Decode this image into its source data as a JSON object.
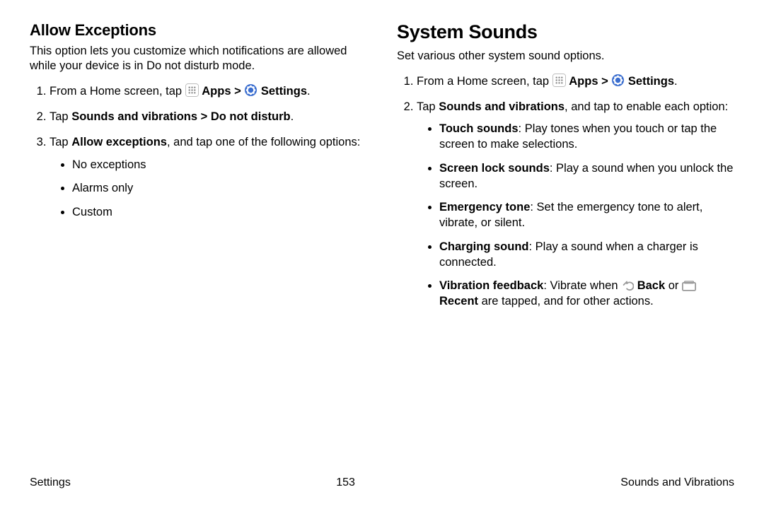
{
  "left": {
    "heading": "Allow Exceptions",
    "lead": "This option lets you customize which notifications are allowed while your device is in Do not disturb mode.",
    "step1_pre": "From a Home screen, tap ",
    "apps": "Apps",
    "gt": " > ",
    "settings": "Settings",
    "period": ".",
    "step2_pre": "Tap ",
    "step2_bold": "Sounds and vibrations > Do not disturb",
    "step3_pre": "Tap ",
    "step3_bold": "Allow exceptions",
    "step3_post": ", and tap one of the following options:",
    "opts": [
      "No exceptions",
      "Alarms only",
      "Custom"
    ]
  },
  "right": {
    "heading": "System Sounds",
    "lead": "Set various other system sound options.",
    "step1_pre": "From a Home screen, tap ",
    "apps": "Apps",
    "gt": " > ",
    "settings": "Settings",
    "period": ".",
    "step2_pre": "Tap ",
    "step2_bold": "Sounds and vibrations",
    "step2_post": ", and tap to enable each option:",
    "opts": {
      "touch_b": "Touch sounds",
      "touch_t": ": Play tones when you touch or tap the screen to make selections.",
      "lock_b": "Screen lock sounds",
      "lock_t": ": Play a sound when you unlock the screen.",
      "emerg_b": "Emergency tone",
      "emerg_t": ": Set the emergency tone to alert, vibrate, or silent.",
      "charge_b": "Charging sound",
      "charge_t": ": Play a sound when a charger is connected.",
      "vib_b": "Vibration feedback",
      "vib_t1": ": Vibrate when ",
      "vib_back": "Back",
      "vib_t2": " or ",
      "vib_recent": "Recent",
      "vib_t3": " are tapped, and for other actions."
    }
  },
  "footer": {
    "left": "Settings",
    "center": "153",
    "right": "Sounds and Vibrations"
  }
}
